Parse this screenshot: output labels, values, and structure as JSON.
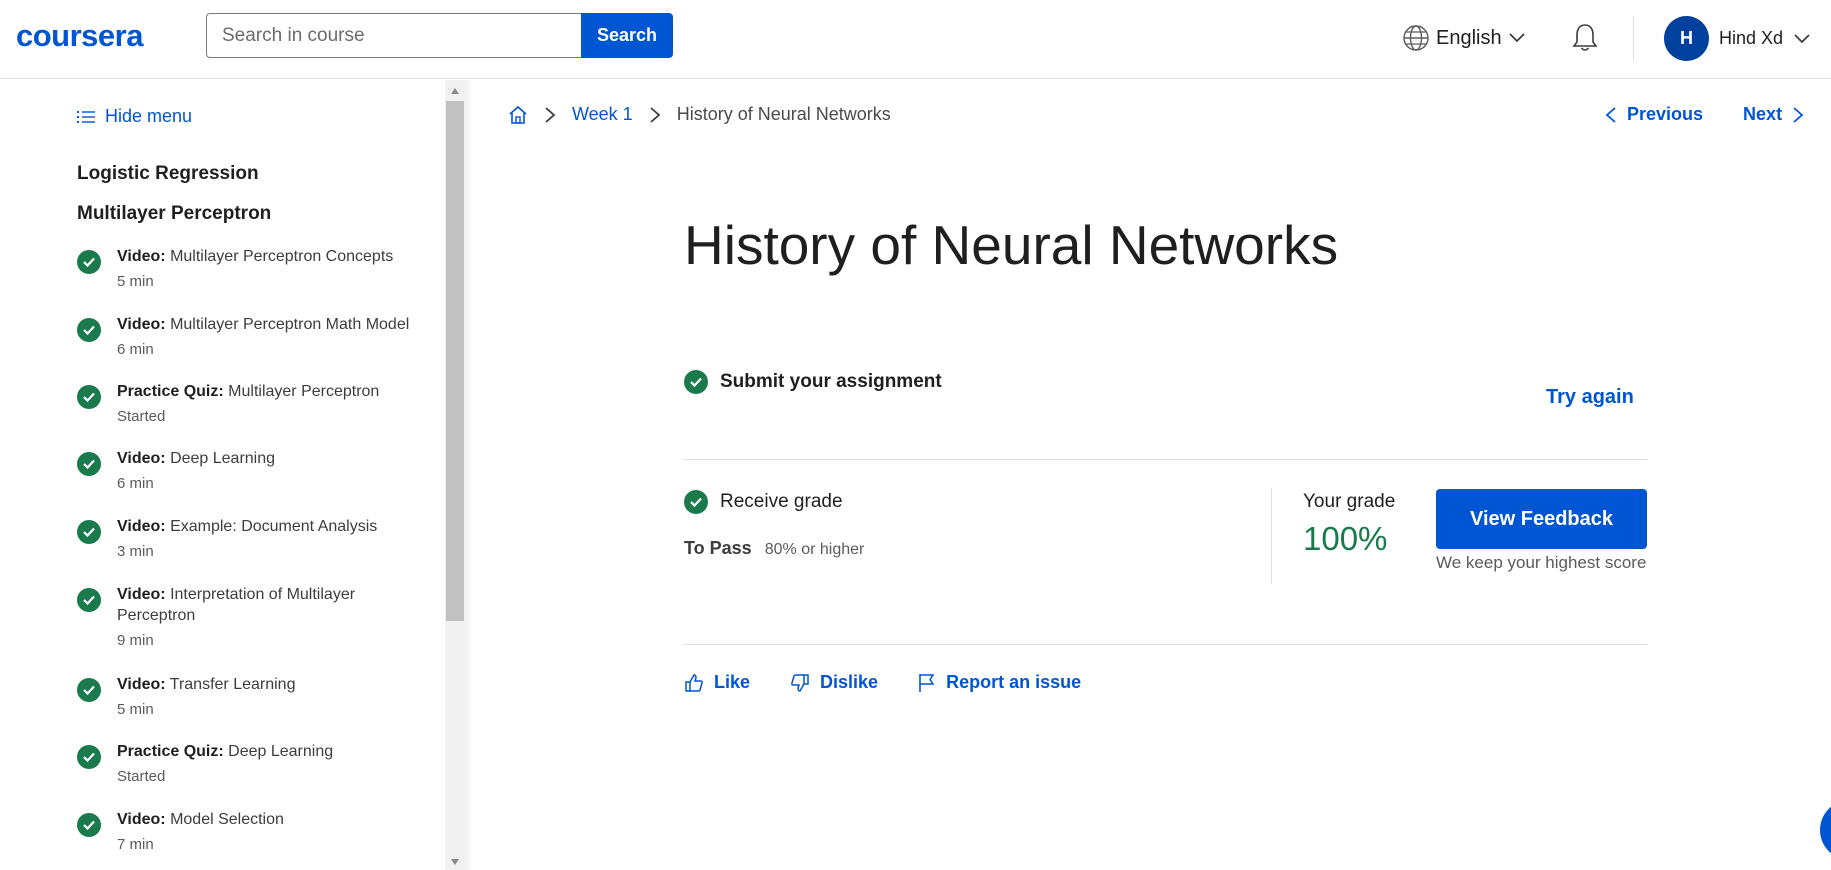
{
  "header": {
    "logo": "coursera",
    "search_placeholder": "Search in course",
    "search_button": "Search",
    "language": "English",
    "user_initial": "H",
    "user_name": "Hind Xd"
  },
  "sidebar": {
    "hide_menu": "Hide menu",
    "sections": [
      "Logistic Regression",
      "Multilayer Perceptron"
    ],
    "items": [
      {
        "type": "Video:",
        "title": "Multilayer Perceptron Concepts",
        "meta": "5 min"
      },
      {
        "type": "Video:",
        "title": "Multilayer Perceptron Math Model",
        "meta": "6 min"
      },
      {
        "type": "Practice Quiz:",
        "title": "Multilayer Perceptron",
        "meta": "Started"
      },
      {
        "type": "Video:",
        "title": "Deep Learning",
        "meta": "6 min"
      },
      {
        "type": "Video:",
        "title": "Example: Document Analysis",
        "meta": "3 min"
      },
      {
        "type": "Video:",
        "title": "Interpretation of Multilayer Perceptron",
        "meta": "9 min"
      },
      {
        "type": "Video:",
        "title": "Transfer Learning",
        "meta": "5 min"
      },
      {
        "type": "Practice Quiz:",
        "title": "Deep Learning",
        "meta": "Started"
      },
      {
        "type": "Video:",
        "title": "Model Selection",
        "meta": "7 min"
      }
    ]
  },
  "breadcrumb": {
    "week": "Week 1",
    "current": "History of Neural Networks"
  },
  "nav": {
    "previous": "Previous",
    "next": "Next"
  },
  "main": {
    "title": "History of Neural Networks",
    "submit_label": "Submit your assignment",
    "try_again": "Try again",
    "receive_grade": "Receive grade",
    "to_pass_label": "To Pass",
    "to_pass_value": "80% or higher",
    "your_grade_label": "Your grade",
    "grade_value": "100%",
    "view_feedback": "View Feedback",
    "keep_score": "We keep your highest score"
  },
  "feedback": {
    "like": "Like",
    "dislike": "Dislike",
    "report": "Report an issue"
  },
  "colors": {
    "brand_blue": "#0056d2",
    "success_green": "#1a7a4c"
  }
}
